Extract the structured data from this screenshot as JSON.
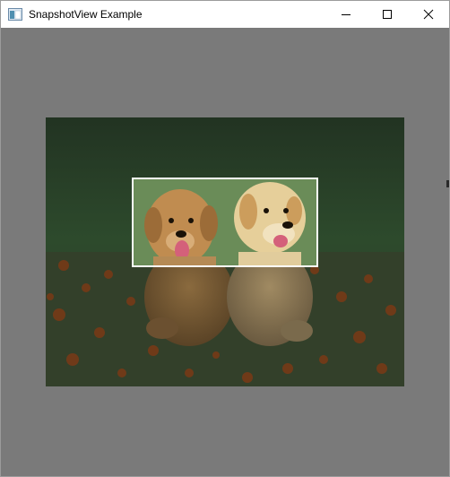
{
  "window": {
    "title": "SnapshotView Example",
    "icon": "app-window-icon",
    "controls": [
      "minimize-icon",
      "maximize-icon",
      "close-icon"
    ]
  },
  "content": {
    "image_subject": "two golden retriever puppies sitting on grass with orange flowers",
    "overlay_color": "#7a7a7a",
    "selection_border_color": "#ffffff"
  }
}
